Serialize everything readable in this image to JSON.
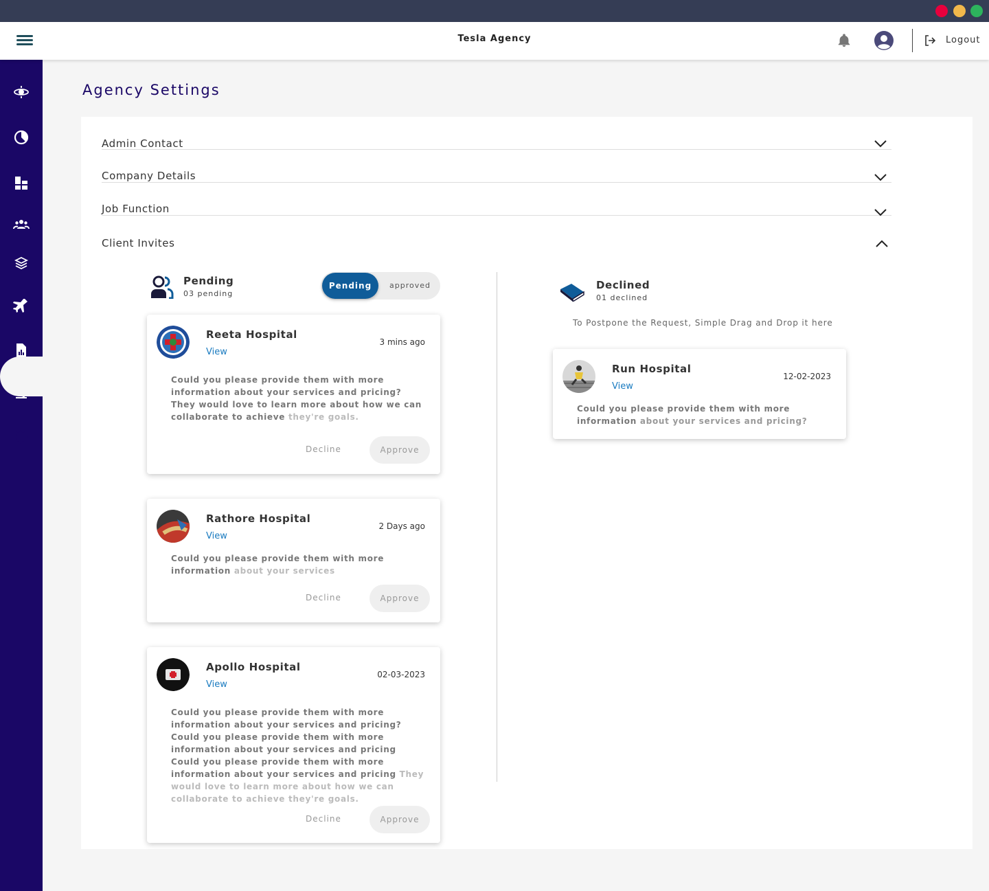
{
  "window": {
    "controls": [
      "close",
      "minimize",
      "maximize"
    ]
  },
  "header": {
    "title": "Tesla Agency",
    "menu_icon": "hamburger-icon",
    "notification_icon": "bell-icon",
    "profile_icon": "user-avatar-icon",
    "logout_label": "Logout"
  },
  "sidebar": {
    "items": [
      {
        "icon": "orbit-icon"
      },
      {
        "icon": "pie-chart-icon"
      },
      {
        "icon": "dashboard-icon"
      },
      {
        "icon": "users-icon"
      },
      {
        "icon": "layers-icon"
      },
      {
        "icon": "airplane-icon"
      },
      {
        "icon": "report-icon"
      },
      {
        "icon": "microscope-icon"
      },
      {
        "icon": "settings-icon",
        "active": true
      }
    ]
  },
  "page": {
    "title": "Agency Settings"
  },
  "accordion": [
    {
      "label": "Admin Contact",
      "expanded": false
    },
    {
      "label": "Company Details",
      "expanded": false
    },
    {
      "label": "Job Function",
      "expanded": false
    },
    {
      "label": "Client Invites",
      "expanded": true
    }
  ],
  "pending": {
    "title": "Pending",
    "subtitle": "03 pending",
    "toggle": {
      "active": "Pending",
      "inactive": "approved"
    },
    "cards": [
      {
        "name": "Reeta Hospital",
        "view": "View",
        "time": "3 mins ago",
        "message": "Could you please provide them with more information about your services and pricing? They would love to learn more about how we can collaborate to achieve",
        "message_faded": "they're  goals.",
        "decline": "Decline",
        "approve": "Approve"
      },
      {
        "name": "Rathore Hospital",
        "view": "View",
        "time": "2 Days ago",
        "message": "Could you please provide them with more information",
        "message_faded": "about your services",
        "decline": "Decline",
        "approve": "Approve"
      },
      {
        "name": "Apollo Hospital",
        "view": "View",
        "time": "02-03-2023",
        "message": "Could you please provide them with more information about your services and pricing? Could you please provide them with more information about your services and pricing Could you please provide them with more information about your services and pricing",
        "message_faded": "They would love to learn more about how we can collaborate to achieve they're  goals.",
        "decline": "Decline",
        "approve": "Approve"
      }
    ]
  },
  "declined": {
    "title": "Declined",
    "subtitle": "01 declined",
    "hint": "To Postpone the Request, Simple Drag and Drop it here",
    "cards": [
      {
        "name": "Run Hospital",
        "view": "View",
        "time": "12-02-2023",
        "message": "Could you please provide them with more information",
        "message_faded": "about your services and pricing?"
      }
    ]
  },
  "colors": {
    "sidebar": "#1a0766",
    "accent": "#0f5c99",
    "link": "#1a7bc0",
    "title": "#1a0766"
  }
}
